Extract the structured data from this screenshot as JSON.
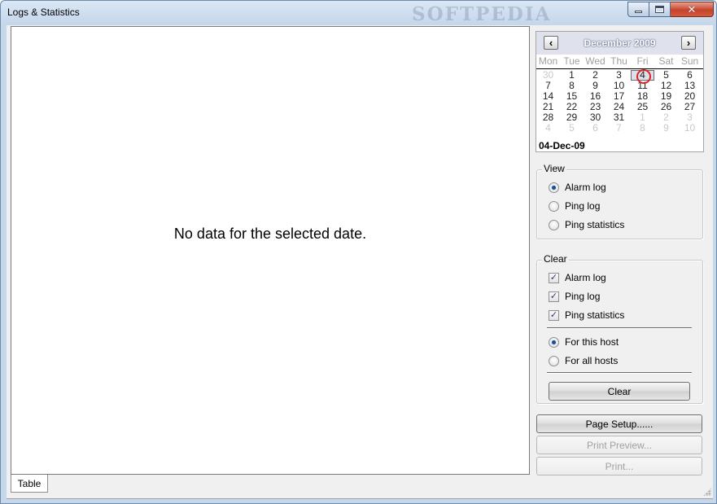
{
  "window": {
    "title": "Logs  & Statistics",
    "watermark": "SOFTPEDIA",
    "controls": {
      "minimize": "minimize-icon",
      "maximize": "maximize-icon",
      "close": "close-icon"
    }
  },
  "content": {
    "message": "No data for the selected date.",
    "tabs": [
      {
        "label": "Table"
      }
    ]
  },
  "calendar": {
    "month_label": "December 2009",
    "weekdays": [
      "Mon",
      "Tue",
      "Wed",
      "Thu",
      "Fri",
      "Sat",
      "Sun"
    ],
    "weeks": [
      [
        "30",
        "1",
        "2",
        "3",
        "4",
        "5",
        "6"
      ],
      [
        "7",
        "8",
        "9",
        "10",
        "11",
        "12",
        "13"
      ],
      [
        "14",
        "15",
        "16",
        "17",
        "18",
        "19",
        "20"
      ],
      [
        "21",
        "22",
        "23",
        "24",
        "25",
        "26",
        "27"
      ],
      [
        "28",
        "29",
        "30",
        "31",
        "1",
        "2",
        "3"
      ],
      [
        "4",
        "5",
        "6",
        "7",
        "8",
        "9",
        "10"
      ]
    ],
    "selected_day": "4",
    "selected_date": "04-Dec-09",
    "highlight_color": "#dd2222"
  },
  "view": {
    "title": "View",
    "options": [
      {
        "label": "Alarm log",
        "selected": true
      },
      {
        "label": "Ping log",
        "selected": false
      },
      {
        "label": "Ping statistics",
        "selected": false
      }
    ]
  },
  "clear": {
    "title": "Clear",
    "checks": [
      {
        "label": "Alarm log",
        "checked": true
      },
      {
        "label": "Ping log",
        "checked": true
      },
      {
        "label": "Ping statistics",
        "checked": true
      }
    ],
    "scope": [
      {
        "label": "For this host",
        "selected": true
      },
      {
        "label": "For all hosts",
        "selected": false
      }
    ],
    "button_label": "Clear"
  },
  "actions": {
    "page_setup": "Page Setup......",
    "print_preview": "Print Preview...",
    "print": "Print..."
  }
}
